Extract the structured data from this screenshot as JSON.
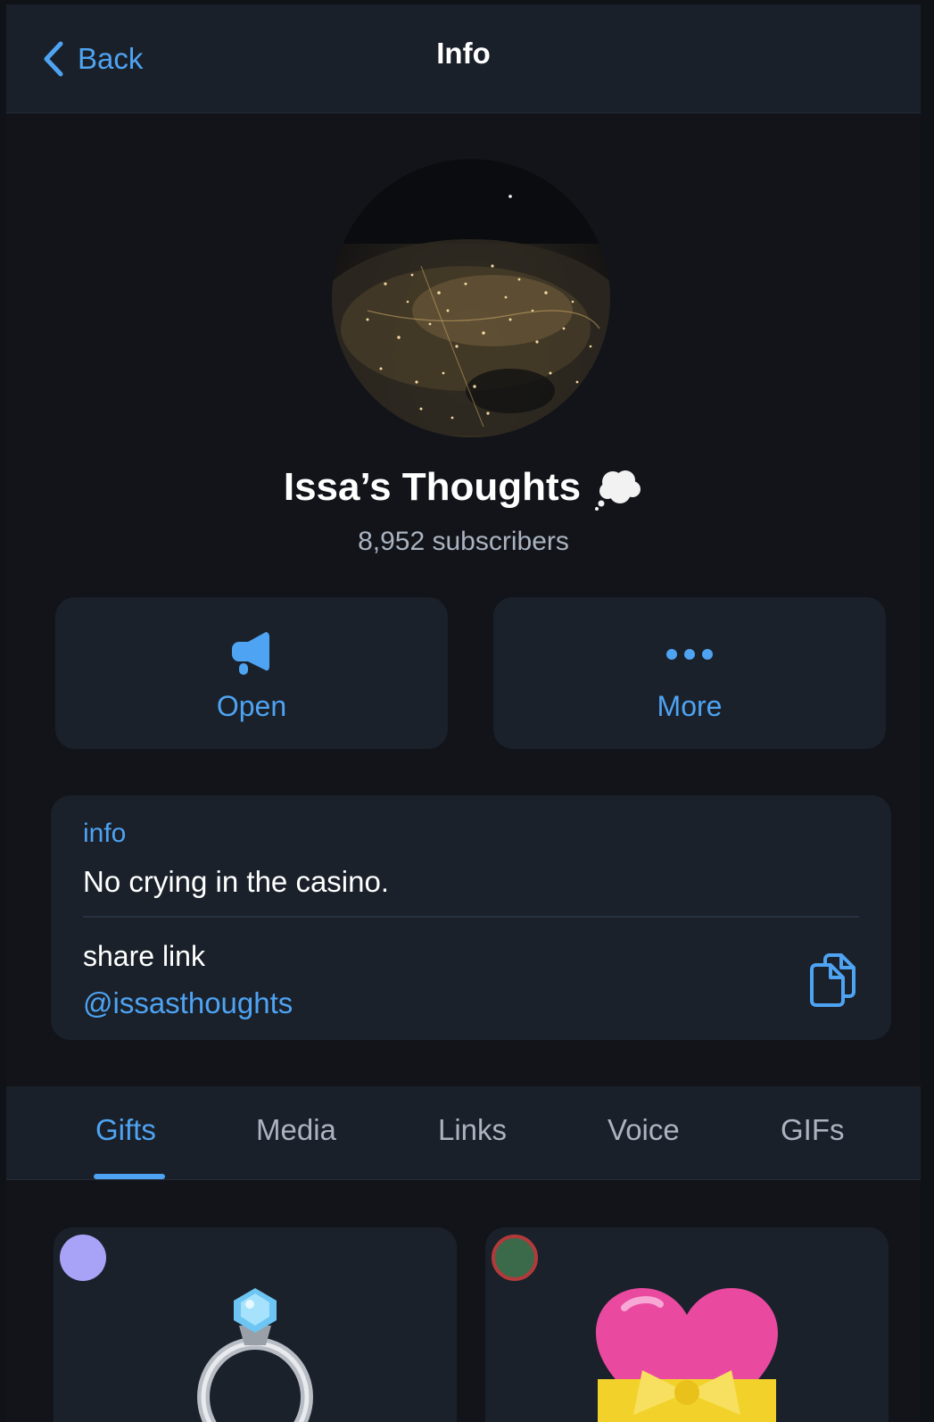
{
  "header": {
    "back_label": "Back",
    "title": "Info"
  },
  "profile": {
    "name": "Issa’s Thoughts",
    "subscribers": "8,952 subscribers"
  },
  "actions": [
    {
      "label": "Open",
      "icon": "megaphone-icon"
    },
    {
      "label": "More",
      "icon": "more-dots-icon"
    }
  ],
  "info_card": {
    "info_label": "info",
    "info_text": "No crying in the casino.",
    "share_label": "share link",
    "share_link": "@issasthoughts",
    "copy_icon": "copy-icon"
  },
  "tabs": [
    {
      "label": "Gifts",
      "active": true
    },
    {
      "label": "Media",
      "active": false
    },
    {
      "label": "Links",
      "active": false
    },
    {
      "label": "Voice",
      "active": false
    },
    {
      "label": "GIFs",
      "active": false
    }
  ],
  "gifts": [
    {
      "icon": "diamond-ring-icon",
      "badge_color": "#a9a3f7"
    },
    {
      "icon": "heart-with-ribbon-icon",
      "badge_color": "#3a6a4a"
    }
  ],
  "colors": {
    "accent": "#4ea3f2",
    "background": "#121419",
    "card": "#1a212b",
    "secondary_text": "#aab3c0"
  }
}
